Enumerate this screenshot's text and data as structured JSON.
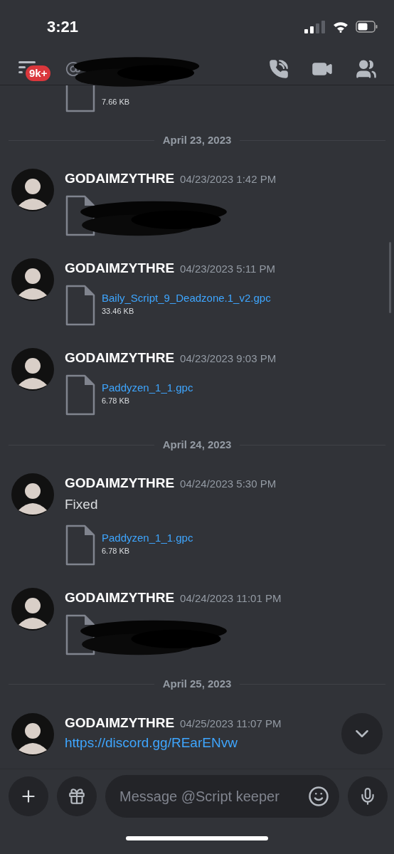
{
  "status_bar": {
    "time": "3:21"
  },
  "header": {
    "unread_badge": "9k+"
  },
  "feed": [
    {
      "kind": "partial_file",
      "size": "7.66 KB"
    },
    {
      "kind": "date",
      "label": "April 23, 2023"
    },
    {
      "kind": "message",
      "author": "GODAIMZYTHRE",
      "time": "04/23/2023 1:42 PM",
      "attachments": [
        {
          "kind": "redacted_file"
        }
      ]
    },
    {
      "kind": "message",
      "author": "GODAIMZYTHRE",
      "time": "04/23/2023 5:11 PM",
      "attachments": [
        {
          "kind": "file",
          "name": "Baily_Script_9_Deadzone.1_v2.gpc",
          "size": "33.46 KB"
        }
      ]
    },
    {
      "kind": "message",
      "author": "GODAIMZYTHRE",
      "time": "04/23/2023 9:03 PM",
      "attachments": [
        {
          "kind": "file",
          "name": "Paddyzen_1_1.gpc",
          "size": "6.78 KB"
        }
      ]
    },
    {
      "kind": "date",
      "label": "April 24, 2023"
    },
    {
      "kind": "message",
      "author": "GODAIMZYTHRE",
      "time": "04/24/2023 5:30 PM",
      "text": "Fixed",
      "attachments": [
        {
          "kind": "file",
          "name": "Paddyzen_1_1.gpc",
          "size": "6.78 KB"
        }
      ]
    },
    {
      "kind": "message",
      "author": "GODAIMZYTHRE",
      "time": "04/24/2023 11:01 PM",
      "attachments": [
        {
          "kind": "redacted_file"
        }
      ]
    },
    {
      "kind": "date",
      "label": "April 25, 2023"
    },
    {
      "kind": "message",
      "author": "GODAIMZYTHRE",
      "time": "04/25/2023 11:07 PM",
      "link": "https://discord.gg/REarENvw"
    }
  ],
  "composer": {
    "placeholder": "Message @Script keeper"
  }
}
